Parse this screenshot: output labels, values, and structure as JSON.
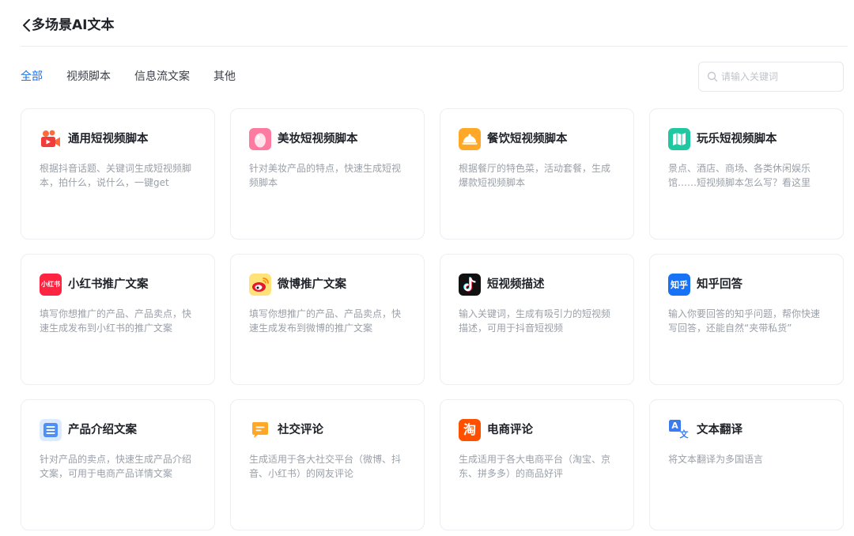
{
  "header": {
    "title": "多场景AI文本"
  },
  "tabs": [
    {
      "label": "全部",
      "active": true
    },
    {
      "label": "视频脚本",
      "active": false
    },
    {
      "label": "信息流文案",
      "active": false
    },
    {
      "label": "其他",
      "active": false
    }
  ],
  "search": {
    "placeholder": "请输入关键词"
  },
  "colors": {
    "accent": "#1a73e8"
  },
  "cards": [
    {
      "title": "通用短视频脚本",
      "desc": "根据抖音话题、关键词生成短视频脚本，拍什么，说什么，一键get",
      "icon": "video-camera-icon"
    },
    {
      "title": "美妆短视频脚本",
      "desc": "针对美妆产品的特点，快速生成短视频脚本",
      "icon": "beauty-egg-icon"
    },
    {
      "title": "餐饮短视频脚本",
      "desc": "根据餐厅的特色菜，活动套餐，生成爆款短视频脚本",
      "icon": "dining-cloche-icon"
    },
    {
      "title": "玩乐短视频脚本",
      "desc": "景点、酒店、商场、各类休闲娱乐馆……短视频脚本怎么写？看这里",
      "icon": "map-icon"
    },
    {
      "title": "小红书推广文案",
      "desc": "填写你想推广的产品、产品卖点，快速生成发布到小红书的推广文案",
      "icon": "xiaohongshu-logo-icon",
      "icon_text": "小红书"
    },
    {
      "title": "微博推广文案",
      "desc": "填写你想推广的产品、产品卖点，快速生成发布到微博的推广文案",
      "icon": "weibo-logo-icon"
    },
    {
      "title": "短视频描述",
      "desc": "输入关键词，生成有吸引力的短视频描述，可用于抖音短视频",
      "icon": "douyin-logo-icon"
    },
    {
      "title": "知乎回答",
      "desc": "输入你要回答的知乎问题，帮你快速写回答，还能自然“夹带私货”",
      "icon": "zhihu-logo-icon",
      "icon_text": "知乎"
    },
    {
      "title": "产品介绍文案",
      "desc": "针对产品的卖点，快速生成产品介绍文案，可用于电商产品详情文案",
      "icon": "document-lines-icon"
    },
    {
      "title": "社交评论",
      "desc": "生成适用于各大社交平台（微博、抖音、小红书）的网友评论",
      "icon": "comment-bubble-icon"
    },
    {
      "title": "电商评论",
      "desc": "生成适用于各大电商平台（淘宝、京东、拼多多）的商品好评",
      "icon": "taobao-logo-icon",
      "icon_text": "淘"
    },
    {
      "title": "文本翻译",
      "desc": "将文本翻译为多国语言",
      "icon": "translate-icon",
      "icon_text_a": "A",
      "icon_text_b": "文"
    }
  ]
}
